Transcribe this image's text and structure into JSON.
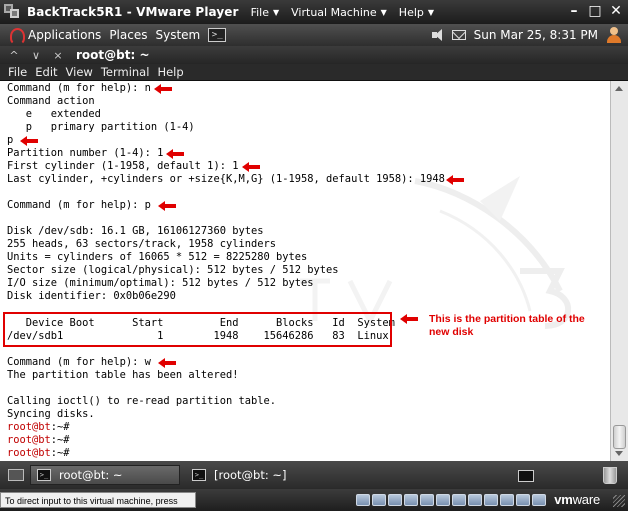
{
  "vmware": {
    "title": "BackTrack5R1 - VMware Player",
    "menus": [
      "File",
      "Virtual Machine",
      "Help"
    ],
    "window_controls": [
      "–",
      "□",
      "✕"
    ],
    "status_text": "To direct input to this virtual machine, press Ctrl+G.",
    "logo": {
      "a": "vm",
      "b": "ware"
    }
  },
  "panel": {
    "menus": [
      "Applications",
      "Places",
      "System"
    ],
    "terminal_glyph": ">_",
    "datetime": "Sun Mar 25,  8:31 PM"
  },
  "terminal": {
    "controls": [
      "^",
      "∨",
      "×"
    ],
    "title": "root@bt: ~",
    "menus": [
      "File",
      "Edit",
      "View",
      "Terminal",
      "Help"
    ],
    "lines": [
      "Command (m for help): n",
      "Command action",
      "   e   extended",
      "   p   primary partition (1-4)",
      "p",
      "Partition number (1-4): 1",
      "First cylinder (1-1958, default 1): 1",
      "Last cylinder, +cylinders or +size{K,M,G} (1-1958, default 1958): 1948",
      "",
      "Command (m for help): p",
      "",
      "Disk /dev/sdb: 16.1 GB, 16106127360 bytes",
      "255 heads, 63 sectors/track, 1958 cylinders",
      "Units = cylinders of 16065 * 512 = 8225280 bytes",
      "Sector size (logical/physical): 512 bytes / 512 bytes",
      "I/O size (minimum/optimal): 512 bytes / 512 bytes",
      "Disk identifier: 0x0b06e290",
      "",
      "   Device Boot      Start         End      Blocks   Id  System",
      "/dev/sdb1               1        1948    15646286   83  Linux",
      "",
      "Command (m for help): w",
      "The partition table has been altered!",
      "",
      "Calling ioctl() to re-read partition table.",
      "Syncing disks."
    ],
    "prompts": [
      {
        "user": "root@bt",
        "rest": ":~#"
      },
      {
        "user": "root@bt",
        "rest": ":~#"
      },
      {
        "user": "root@bt",
        "rest": ":~#"
      }
    ],
    "annotation": "This is the partition table of the new disk"
  },
  "taskbar": {
    "tasks": [
      "root@bt: ~",
      "[root@bt: ~]"
    ],
    "task_icon_glyph": ">_"
  },
  "colors": {
    "annotation_red": "#e00000",
    "prompt_red": "#c00000",
    "terminal_bg": "#ffffff"
  }
}
